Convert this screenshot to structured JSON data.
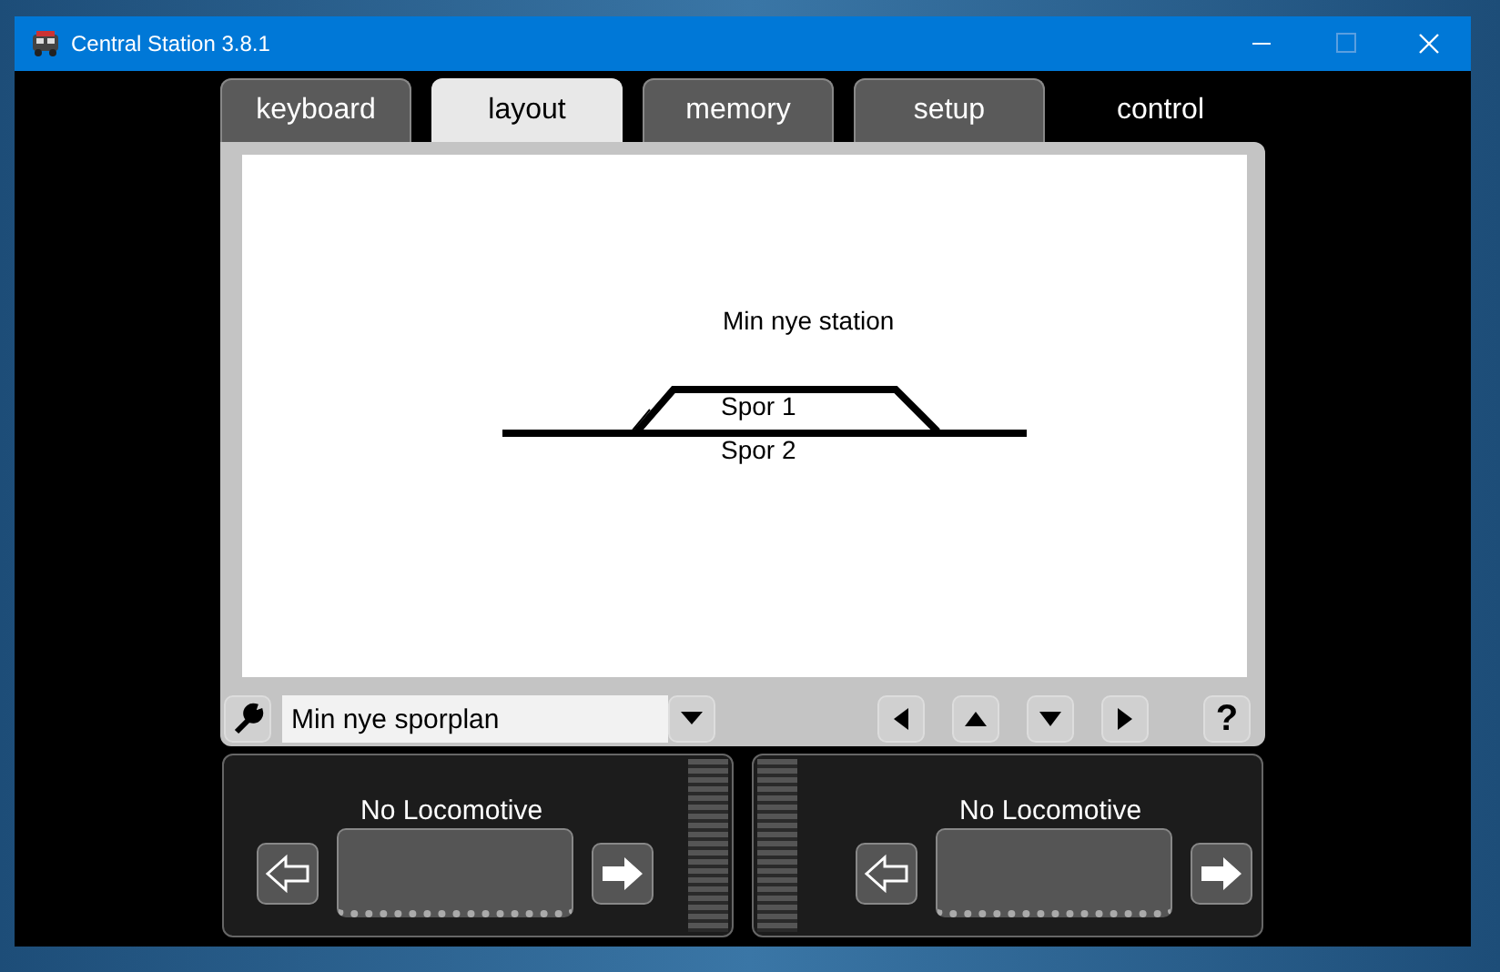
{
  "window": {
    "title": "Central Station 3.8.1"
  },
  "tabs": [
    {
      "label": "keyboard",
      "kind": "tab",
      "selected": false
    },
    {
      "label": "layout",
      "kind": "tab",
      "selected": true
    },
    {
      "label": "memory",
      "kind": "tab",
      "selected": false
    },
    {
      "label": "setup",
      "kind": "tab",
      "selected": false
    },
    {
      "label": "control",
      "kind": "plain",
      "selected": false
    }
  ],
  "layout": {
    "station_name": "Min nye station",
    "tracks": [
      {
        "label": "Spor 1",
        "kind": "siding"
      },
      {
        "label": "Spor 2",
        "kind": "main"
      }
    ]
  },
  "toolbar": {
    "plan_name": "Min nye sporplan",
    "help": "?"
  },
  "throttles": [
    {
      "locomotive": "No Locomotive",
      "kind": "slider-right",
      "level": 0
    },
    {
      "locomotive": "No Locomotive",
      "kind": "slider-left",
      "level": 0
    }
  ]
}
